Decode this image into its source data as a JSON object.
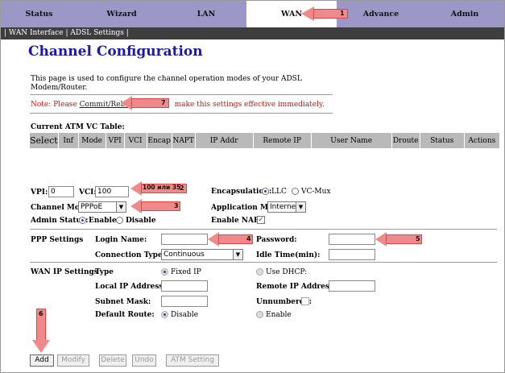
{
  "nav": {
    "tabs": [
      "Status",
      "Wizard",
      "LAN",
      "WAN",
      "Advance",
      "Admin"
    ],
    "active": "WAN",
    "sub_sep": "|",
    "sub_items": [
      "WAN Interface",
      "ADSL Settings"
    ]
  },
  "page": {
    "title": "Channel Configuration",
    "description": "This page is used to configure the channel operation modes of your ADSL Modem/Router.",
    "note_prefix": "Note: Please ",
    "note_link": "Commit/Reboot",
    "note_suffix": " make this settings effective immediately."
  },
  "vc_table": {
    "caption": "Current ATM VC Table:",
    "headers": [
      "Select",
      "Inf",
      "Mode",
      "VPI",
      "VCI",
      "Encap",
      "NAPT",
      "IP Addr",
      "Remote IP",
      "User Name",
      "Droute",
      "Status",
      "Actions"
    ]
  },
  "form": {
    "vpi_label": "VPI:",
    "vpi_value": "0",
    "vci_label": "VCI:",
    "vci_value": "100",
    "encap_label": "Encapsulation:",
    "encap_llc": "LLC",
    "encap_vcmux": "VC-Mux",
    "channel_mode_label": "Channel Mode",
    "channel_mode_value": "PPPoE",
    "app_mode_label": "Application Mode",
    "app_mode_value": "Internet",
    "admin_status_label": "Admin Status:",
    "admin_enable": "Enable",
    "admin_disable": "Disable",
    "enable_napt_label": "Enable NAPT"
  },
  "ppp": {
    "section": "PPP Settings",
    "login_label": "Login Name:",
    "login_value": "",
    "password_label": "Password:",
    "password_value": "",
    "conn_type_label": "Connection Type:",
    "conn_type_value": "Continuous",
    "idle_label": "Idle Time(min):",
    "idle_value": ""
  },
  "wanip": {
    "section": "WAN IP Settings",
    "type_label": "Type",
    "fixed_ip": "Fixed IP",
    "use_dhcp": "Use DHCP:",
    "local_ip_label": "Local IP Address:",
    "remote_ip_label": "Remote IP Address:",
    "subnet_label": "Subnet Mask:",
    "unnumbered_label": "Unnumbered:",
    "default_route_label": "Default Route:",
    "disable": "Disable",
    "enable": "Enable"
  },
  "buttons": {
    "add": "Add",
    "modify": "Modify",
    "delete": "Delete",
    "undo": "Undo",
    "atm": "ATM Setting"
  },
  "callouts": {
    "c1": "1",
    "c2": "2",
    "c2_text": "100 или 35",
    "c3": "3",
    "c4": "4",
    "c5": "5",
    "c6": "6",
    "c7": "7",
    "color": "#f08a8a"
  }
}
